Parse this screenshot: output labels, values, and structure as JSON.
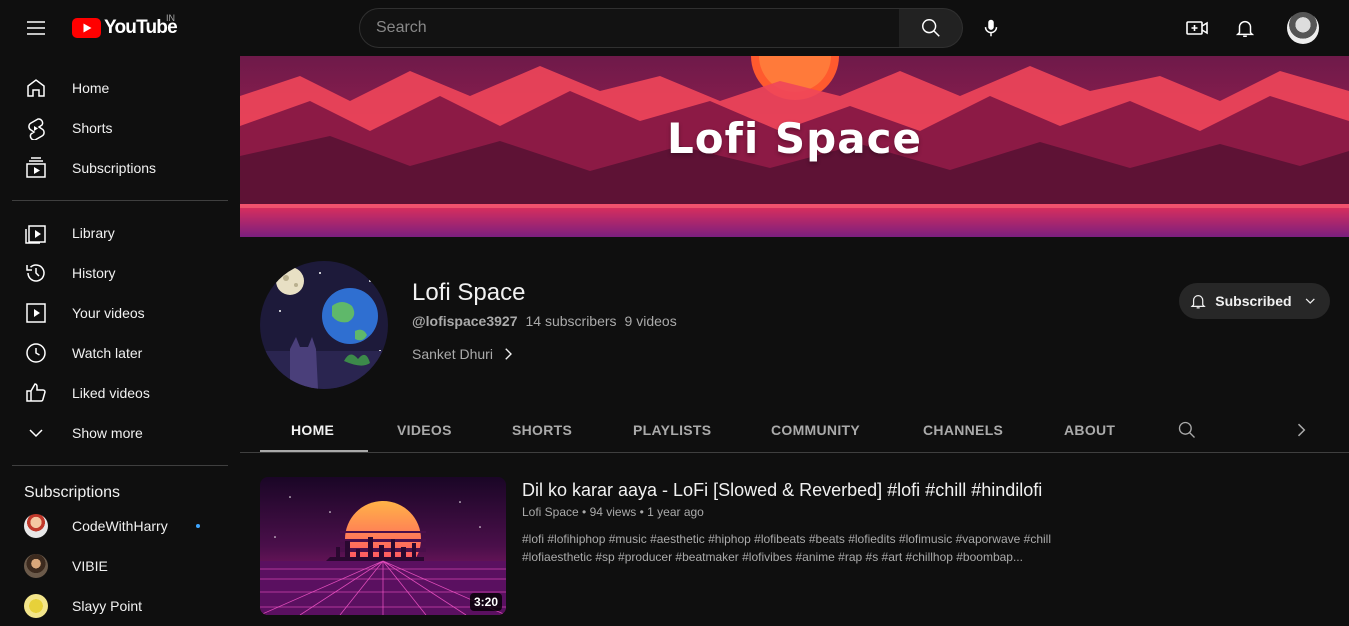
{
  "header": {
    "logo_text": "YouTube",
    "country_code": "IN",
    "search_placeholder": "Search"
  },
  "sidebar": {
    "main": [
      {
        "label": "Home",
        "icon": "home-icon"
      },
      {
        "label": "Shorts",
        "icon": "shorts-icon"
      },
      {
        "label": "Subscriptions",
        "icon": "subscriptions-icon"
      }
    ],
    "library": [
      {
        "label": "Library",
        "icon": "library-icon"
      },
      {
        "label": "History",
        "icon": "history-icon"
      },
      {
        "label": "Your videos",
        "icon": "your-videos-icon"
      },
      {
        "label": "Watch later",
        "icon": "watch-later-icon"
      },
      {
        "label": "Liked videos",
        "icon": "liked-videos-icon"
      },
      {
        "label": "Show more",
        "icon": "chevron-down-icon"
      }
    ],
    "subscriptions_heading": "Subscriptions",
    "subscriptions": [
      {
        "label": "CodeWithHarry",
        "has_new": true
      },
      {
        "label": "VIBIE",
        "has_new": false
      },
      {
        "label": "Slayy Point",
        "has_new": false
      }
    ]
  },
  "banner": {
    "title": "Lofi Space"
  },
  "channel": {
    "name": "Lofi Space",
    "handle": "@lofispace3927",
    "subscribers": "14 subscribers",
    "videos": "9 videos",
    "owner": "Sanket Dhuri",
    "subscribe_label": "Subscribed"
  },
  "tabs": [
    {
      "label": "HOME",
      "active": true
    },
    {
      "label": "VIDEOS",
      "active": false
    },
    {
      "label": "SHORTS",
      "active": false
    },
    {
      "label": "PLAYLISTS",
      "active": false
    },
    {
      "label": "COMMUNITY",
      "active": false
    },
    {
      "label": "CHANNELS",
      "active": false
    },
    {
      "label": "ABOUT",
      "active": false
    }
  ],
  "featured_video": {
    "title": "Dil ko karar aaya - LoFi [Slowed & Reverbed] #lofi #chill #hindilofi",
    "meta": "Lofi Space • 94 views • 1 year ago",
    "duration": "3:20",
    "description_line1": "#lofi #lofihiphop #music #aesthetic #hiphop #lofibeats #beats #lofiedits #lofimusic #vaporwave #chill",
    "description_line2": "#lofiaesthetic #sp #producer #beatmaker #lofivibes #anime #rap #s #art #chillhop #boombap..."
  },
  "colors": {
    "background": "#0f0f0f",
    "brand_red": "#ff0000",
    "new_dot": "#3ea6ff"
  }
}
